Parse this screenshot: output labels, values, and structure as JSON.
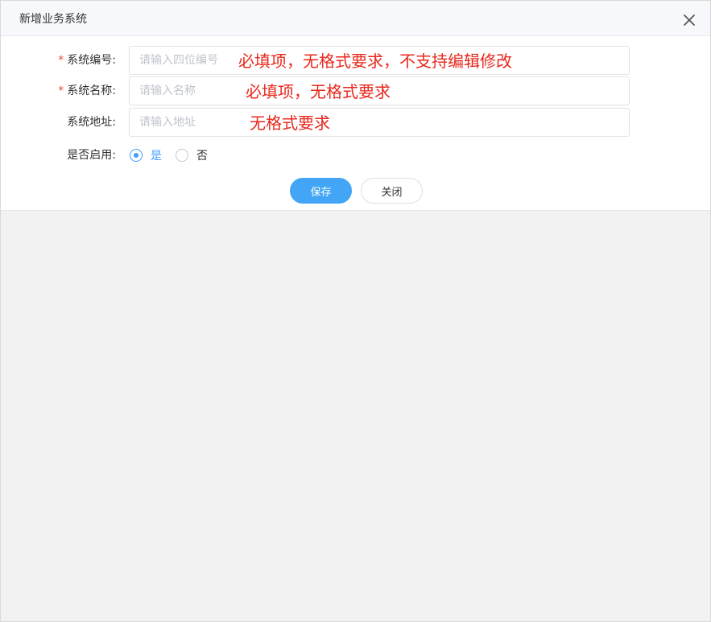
{
  "dialog": {
    "title": "新增业务系统"
  },
  "form": {
    "code": {
      "required_mark": "*",
      "label": "系统编号:",
      "placeholder": "请输入四位编号",
      "value": "",
      "note": "必填项，无格式要求，不支持编辑修改"
    },
    "name": {
      "required_mark": "*",
      "label": "系统名称:",
      "placeholder": "请输入名称",
      "value": "",
      "note": "必填项，无格式要求"
    },
    "address": {
      "label": "系统地址:",
      "placeholder": "请输入地址",
      "value": "",
      "note": "无格式要求"
    },
    "enabled": {
      "label": "是否启用:",
      "options": [
        "是",
        "否"
      ],
      "selected": "是"
    }
  },
  "buttons": {
    "save_label": "保存",
    "close_label": "关闭"
  },
  "colors": {
    "primary": "#42a5f5",
    "required": "#e74c3c",
    "annotation": "#e8281c"
  }
}
